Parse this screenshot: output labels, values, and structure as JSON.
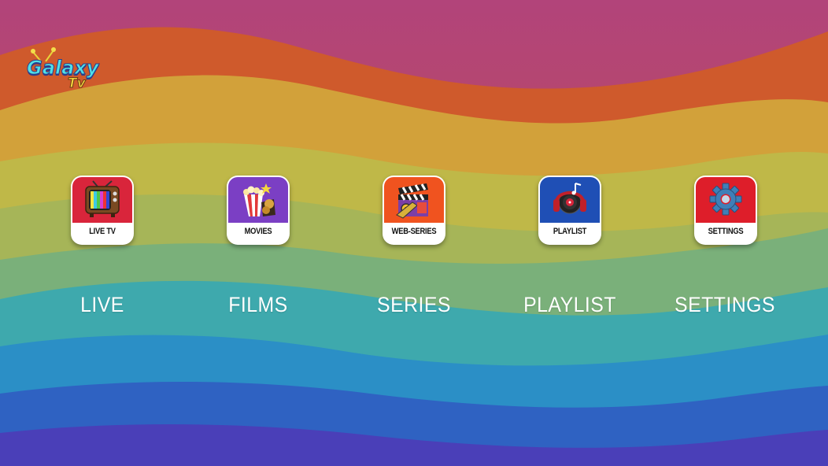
{
  "app": {
    "logo": {
      "word1": "Galaxy",
      "word2": "Tv"
    }
  },
  "menu": [
    {
      "id": "live",
      "icon_label": "LIVE TV",
      "label": "LIVE",
      "icon": "retro-tv-icon",
      "color": "#d9253b"
    },
    {
      "id": "films",
      "icon_label": "MOVIES",
      "label": "FILMS",
      "icon": "popcorn-icon",
      "color": "#7b3fc4"
    },
    {
      "id": "series",
      "icon_label": "WEB-SERIES",
      "label": "SERIES",
      "icon": "clapperboard-icon",
      "color": "#f0531f"
    },
    {
      "id": "playlist",
      "icon_label": "PLAYLIST",
      "label": "PLAYLIST",
      "icon": "headphones-icon",
      "color": "#1f4fb5"
    },
    {
      "id": "settings",
      "icon_label": "SETTINGS",
      "label": "SETTINGS",
      "icon": "gear-icon",
      "color": "#de1e2a"
    }
  ]
}
